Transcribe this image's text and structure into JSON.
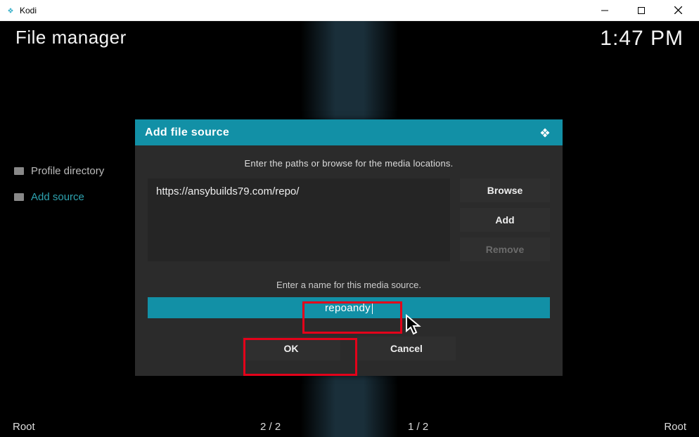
{
  "titlebar": {
    "app_name": "Kodi"
  },
  "header": {
    "title": "File manager",
    "clock": "1:47 PM"
  },
  "sidebar": {
    "items": [
      {
        "label": "Profile directory"
      },
      {
        "label": "Add source"
      }
    ]
  },
  "dialog": {
    "title": "Add file source",
    "instruction_paths": "Enter the paths or browse for the media locations.",
    "path_value": "https://ansybuilds79.com/repo/",
    "browse_label": "Browse",
    "add_label": "Add",
    "remove_label": "Remove",
    "instruction_name": "Enter a name for this media source.",
    "name_value": "repoandy",
    "ok_label": "OK",
    "cancel_label": "Cancel"
  },
  "bottom": {
    "left": "Root",
    "pager_left": "2 / 2",
    "pager_right": "1 / 2",
    "right": "Root"
  }
}
